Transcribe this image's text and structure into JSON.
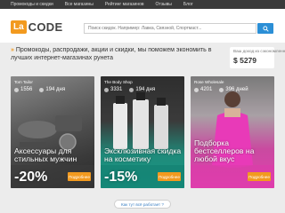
{
  "topnav": {
    "items": [
      "Промокоды и скидки",
      "Все магазины",
      "Рейтинг магазинов",
      "Отзывы",
      "Блог"
    ]
  },
  "header": {
    "logo_box": "La",
    "logo_text": "CODE",
    "search_placeholder": "Поиск скидок. Например: Лавка, Связной, Спортмаст..."
  },
  "promo": {
    "arrows": "»",
    "text": "Промокоды, распродажи, акции и скидки, мы поможем экономить в лучших интернет-магазинах рунета"
  },
  "savings": {
    "label": "Ваш доход из сэкономленного",
    "value": "$ 5279"
  },
  "cards": [
    {
      "store": "Tom Tailor",
      "views": "1556",
      "days": "194 дня",
      "title": "Аксессуары для стильных мужчин",
      "discount": "-20%",
      "button": "Подробнее",
      "accent": "#4a4a4a"
    },
    {
      "store": "The Body Shop",
      "views": "3331",
      "days": "194 дня",
      "title": "Эксклюзивная скидка на косметику",
      "discount": "-15%",
      "button": "Подробнее",
      "accent": "#1e8a7a"
    },
    {
      "store": "Rose Wholesale",
      "views": "4201",
      "days": "396 дней",
      "title": "Подборка бестселлеров на любой вкус",
      "discount": "",
      "button": "Подробнее",
      "accent": "#d63aa8"
    }
  ],
  "how_it_works": "Как тут всё работает ?",
  "colors": {
    "accent": "#f29a1f",
    "search_button": "#2b8fd6",
    "topnav": "#3a3a3a"
  }
}
